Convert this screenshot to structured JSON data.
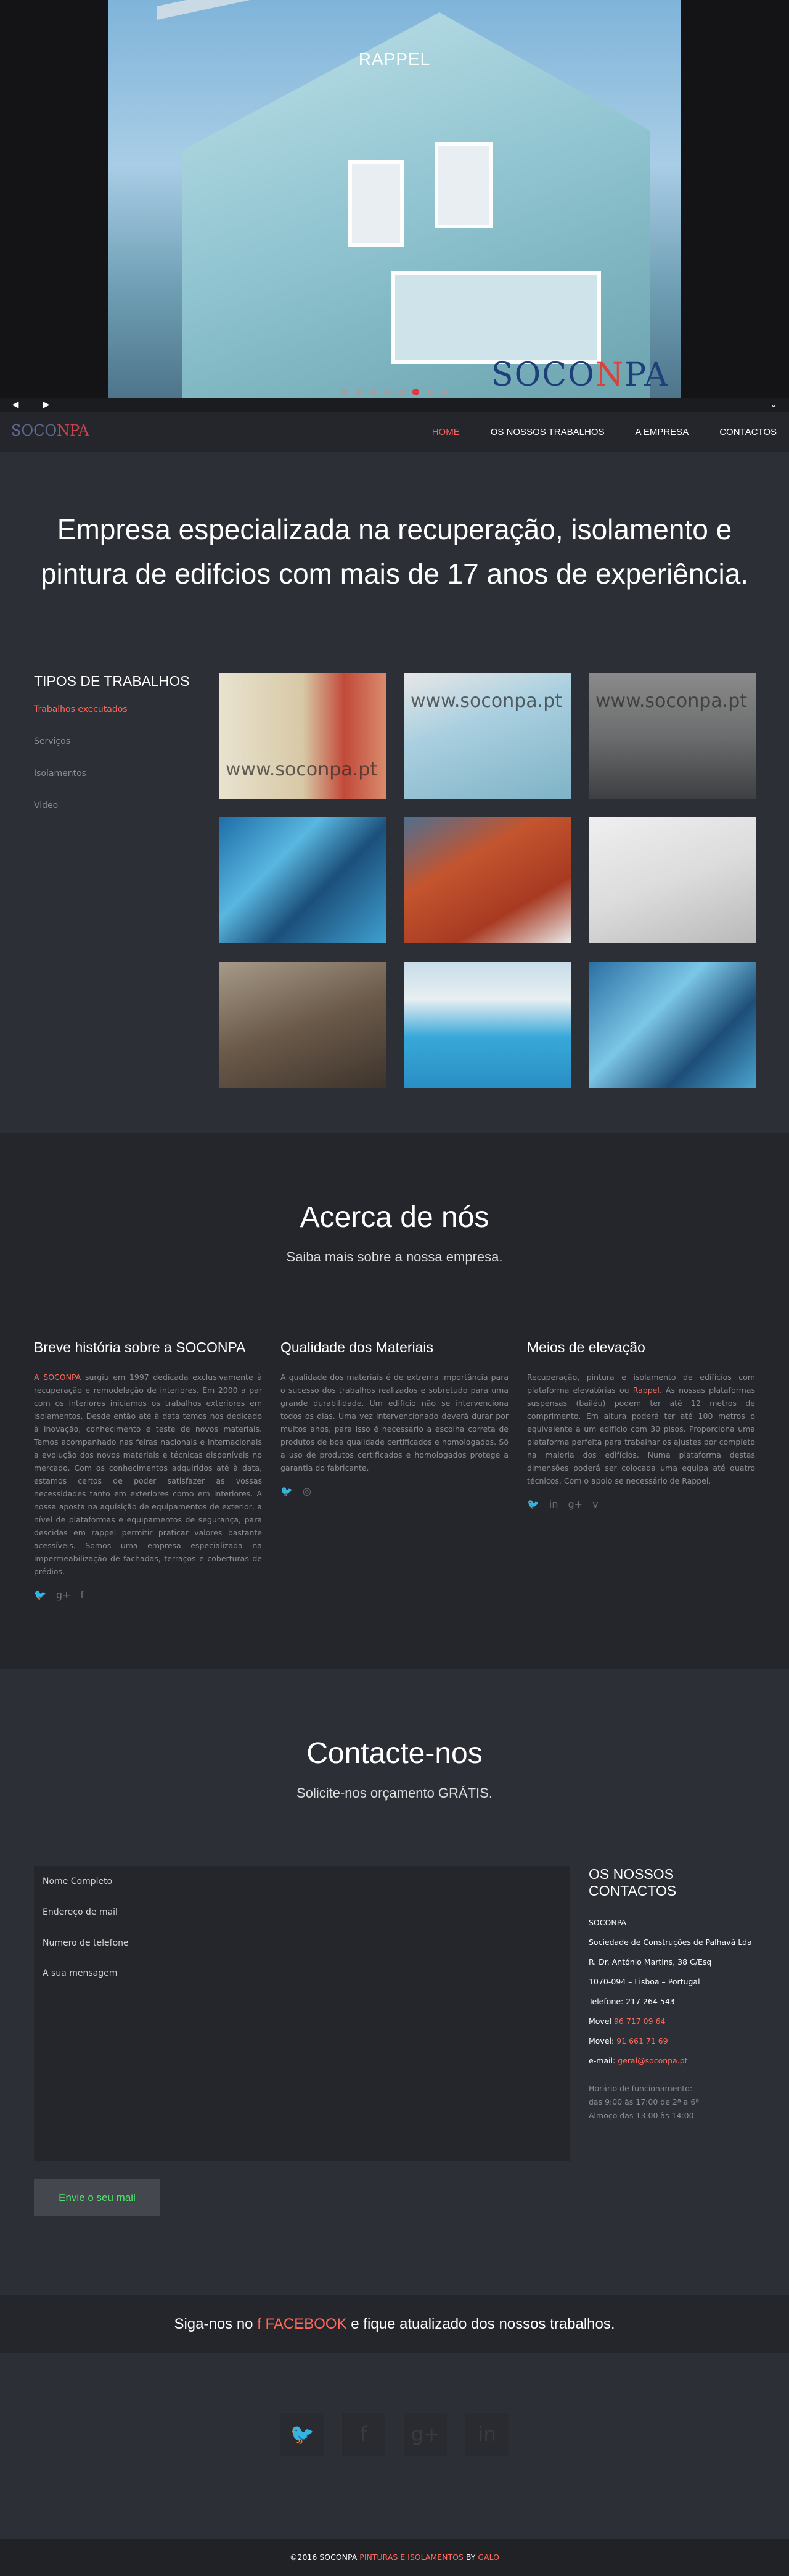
{
  "hero": {
    "caption": "RAPPEL",
    "logo_left": "SOCO",
    "logo_mid": "N",
    "logo_right": "PA",
    "prev_icon": "chevron-left-icon",
    "next_icon": "chevron-right-icon",
    "down_icon": "chevron-down-icon",
    "slides_total": 8,
    "active_slide": 6
  },
  "navbar": {
    "brand_left": "SOCO",
    "brand_mid": "NPA",
    "items": [
      {
        "label": "HOME",
        "active": true
      },
      {
        "label": "OS NOSSOS TRABALHOS",
        "active": false
      },
      {
        "label": "A EMPRESA",
        "active": false
      },
      {
        "label": "CONTACTOS",
        "active": false
      }
    ]
  },
  "intro": {
    "line1": "Empresa especializada na recuperação, isolamento e",
    "line2": "pintura de edifcios com mais de 17 anos de experiência."
  },
  "works": {
    "title": "TIPOS DE TRABALHOS",
    "categories": [
      "Trabalhos executados",
      "Serviços",
      "Isolamentos",
      "Video"
    ],
    "watermark": "www.soconpa.pt",
    "watermark2": "www.soconpa.pt"
  },
  "about": {
    "title": "Acerca de nós",
    "subtitle": "Saiba mais sobre a nossa empresa.",
    "col1": {
      "title": "Breve história sobre a SOCONPA",
      "hl": "A SOCONPA",
      "text": " surgiu em 1997 dedicada exclusivamente à recuperação e remodelação de interiores. Em 2000 a par com os interiores iniciamos os trabalhos exteriores em isolamentos. Desde então até à data temos nos dedicado à inovação, conhecimento e teste de novos materiais. Temos acompanhado nas feiras nacionais e internacionais a evolução dos novos materiais e técnicas disponíveis no mercado. Com os conhecimentos adquiridos até à data, estamos certos de poder satisfazer as vossas necessidades tanto em exteriores como em interiores. A nossa aposta na aquisição de equipamentos de exterior, a nível de plataformas e equipamentos de segurança, para descidas em rappel permitir praticar valores bastante acessíveis. Somos uma empresa especializada na impermeabilização de fachadas, terraços e coberturas de prédios."
    },
    "col2": {
      "title": "Qualidade dos Materiais",
      "text": "A qualidade dos materiais é de extrema importância para o sucesso dos trabalhos realizados e sobretudo para uma grande durabilidade. Um edifício não se intervenciona todos os dias. Uma vez intervencionado deverá durar por muitos anos, para isso é necessário a escolha correta de produtos de boa qualidade certificados e homologados. Só a uso de produtos certificados e homologados protege a garantia do fabricante."
    },
    "col3": {
      "title": "Meios de elevação",
      "text_a": "Recuperação, pintura e isolamento de edifícios com plataforma elevatórias ou ",
      "hl": "Rappel",
      "text_b": ". As nossas plataformas suspensas (bailéu) podem ter até 12 metros de comprimento. Em altura poderá ter até 100 metros o equivalente a um edifício com 30 pisos. Proporciona uma plataforma perfeita para trabalhar os ajustes por completo na maioria dos edifícios. Numa plataforma destas dimensões poderá ser colocada uma equipa até quatro técnicos. Com o apoio se necessário de Rappel."
    }
  },
  "contact": {
    "title": "Contacte-nos",
    "subtitle": "Solicite-nos orçamento GRÁTIS.",
    "ph_name": "Nome Completo",
    "ph_email": "Endereço de mail",
    "ph_phone": "Numero de telefone",
    "ph_msg": "A sua mensagem",
    "send": "Envie o seu mail",
    "info_title": "OS NOSSOS CONTACTOS",
    "company": "SOCONPA",
    "company_full": "Sociedade de Construções de Palhavã Lda",
    "address1": "R. Dr. António Martins, 38 C/Esq",
    "address2": "1070-094 – Lisboa – Portugal",
    "phone": "Telefone: 217 264 543",
    "mobile1_label": "Movel ",
    "mobile1": "96 717 09 64",
    "mobile2_label": "Movel: ",
    "mobile2": "91 661 71 69",
    "email_label": "e-mail: ",
    "email": "geral@soconpa.pt",
    "hours1": "Horário de funcionamento:",
    "hours2": "das 9:00 às 17:00 de 2ª a 6ª",
    "hours3": "Almoço das 13:00 às 14:00"
  },
  "fb": {
    "before": "Siga-nos no ",
    "link": "FACEBOOK",
    "after": " e fique atualizado dos nossos trabalhos."
  },
  "footer": {
    "prefix": "©2016 SOCONPA ",
    "tagline": "PINTURAS E ISOLAMENTOS",
    "by": " BY ",
    "author": "GALO"
  }
}
